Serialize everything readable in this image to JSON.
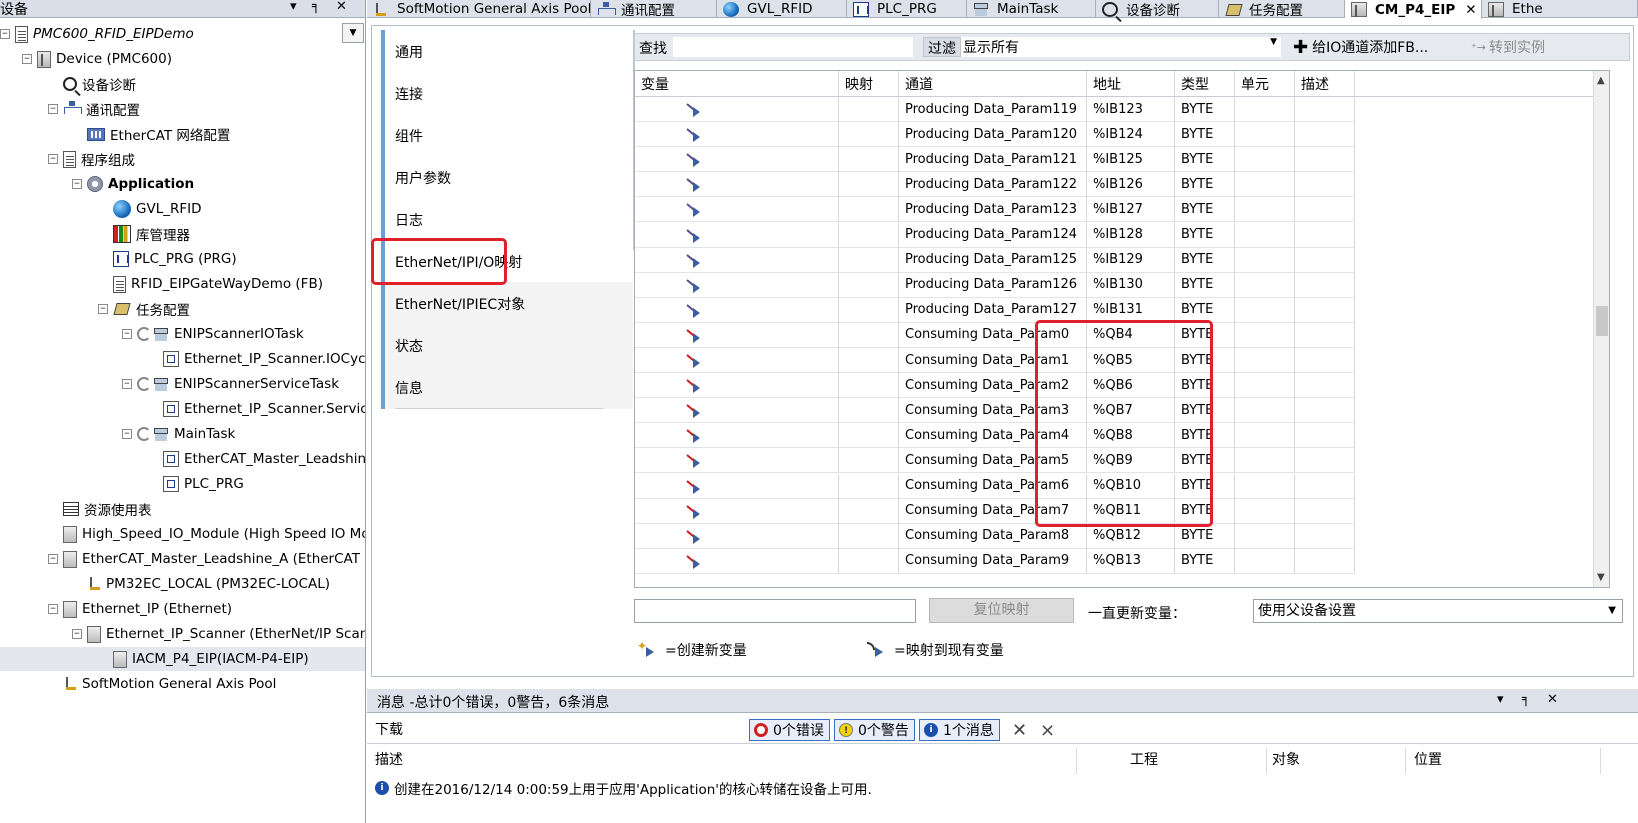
{
  "left_panel": {
    "title": "设备",
    "pin": "▾ ╕ ✕",
    "tree": [
      {
        "label": "PMC600_RFID_EIPDemo",
        "icon": "project-icon",
        "style": "ital",
        "toggle": "⊟"
      },
      {
        "label": "Device (PMC600)",
        "icon": "device-icon",
        "toggle": "⊟"
      },
      {
        "label": "设备诊断",
        "icon": "search-icon"
      },
      {
        "label": "通讯配置",
        "icon": "network-icon",
        "toggle": "⊟"
      },
      {
        "label": "EtherCAT 网络配置",
        "icon": "ethercat-network-icon"
      },
      {
        "label": "程序组成",
        "icon": "program-organization-icon",
        "toggle": "⊟"
      },
      {
        "label": "Application",
        "icon": "application-gear-icon",
        "style": "bold",
        "toggle": "⊟"
      },
      {
        "label": "GVL_RFID",
        "icon": "globe-icon"
      },
      {
        "label": "库管理器",
        "icon": "library-icon"
      },
      {
        "label": "PLC_PRG (PRG)",
        "icon": "program-icon"
      },
      {
        "label": "RFID_EIPGateWayDemo (FB)",
        "icon": "function-block-icon"
      },
      {
        "label": "任务配置",
        "icon": "task-configuration-icon",
        "toggle": "⊟"
      },
      {
        "label": "ENIPScannerIOTask",
        "icon": "task-icon",
        "toggle": "⊟"
      },
      {
        "label": "Ethernet_IP_Scanner.IOCyc",
        "icon": "program-call-icon"
      },
      {
        "label": "ENIPScannerServiceTask",
        "icon": "task-icon",
        "toggle": "⊟"
      },
      {
        "label": "Ethernet_IP_Scanner.Servic",
        "icon": "program-call-icon"
      },
      {
        "label": "MainTask",
        "icon": "task-icon",
        "toggle": "⊟"
      },
      {
        "label": "EtherCAT_Master_Leadshine",
        "icon": "program-call-icon"
      },
      {
        "label": "PLC_PRG",
        "icon": "program-call-icon"
      },
      {
        "label": "资源使用表",
        "icon": "table-icon"
      },
      {
        "label": "High_Speed_IO_Module (High Speed IO Modu",
        "icon": "module-icon"
      },
      {
        "label": "EtherCAT_Master_Leadshine_A (EtherCAT M",
        "icon": "module-icon",
        "toggle": "⊟"
      },
      {
        "label": "PM32EC_LOCAL (PM32EC-LOCAL)",
        "icon": "axis-icon"
      },
      {
        "label": "Ethernet_IP (Ethernet)",
        "icon": "module-icon",
        "toggle": "⊟"
      },
      {
        "label": "Ethernet_IP_Scanner (EtherNet/IP Scann",
        "icon": "module-icon",
        "toggle": "⊟"
      },
      {
        "label": "IACM_P4_EIP(IACM-P4-EIP)",
        "icon": "module-icon",
        "selected": true
      },
      {
        "label": "SoftMotion General Axis Pool",
        "icon": "axis-pool-icon"
      }
    ]
  },
  "tabs": [
    {
      "label": "SoftMotion General Axis Pool",
      "icon": "axis-pool-icon"
    },
    {
      "label": "通讯配置",
      "icon": "network-icon"
    },
    {
      "label": "GVL_RFID",
      "icon": "globe-icon"
    },
    {
      "label": "PLC_PRG",
      "icon": "program-icon"
    },
    {
      "label": "MainTask",
      "icon": "task-icon"
    },
    {
      "label": "设备诊断",
      "icon": "search-icon"
    },
    {
      "label": "任务配置",
      "icon": "task-configuration-icon"
    },
    {
      "label": "CM_P4_EIP",
      "icon": "device-icon",
      "active": true,
      "close": "✕"
    },
    {
      "label": "Ethe",
      "icon": "device-icon"
    }
  ],
  "side_tabs": [
    "通用",
    "连接",
    "组件",
    "用户参数",
    "日志",
    "EtherNet/IPI/O映射",
    "EtherNet/IPIEC对象",
    "状态",
    "信息"
  ],
  "toolbar": {
    "find_label": "查找",
    "filter_label": "过滤",
    "filter_value": "显示所有",
    "add_fb_label": "给IO通道添加FB...",
    "goto_instance_label": "转到实例"
  },
  "grid": {
    "headers": [
      "变量",
      "映射",
      "通道",
      "地址",
      "类型",
      "单元",
      "描述"
    ],
    "rows": [
      {
        "dir": "in",
        "channel": "Producing Data_Param119",
        "address": "%IB123",
        "type": "BYTE"
      },
      {
        "dir": "in",
        "channel": "Producing Data_Param120",
        "address": "%IB124",
        "type": "BYTE"
      },
      {
        "dir": "in",
        "channel": "Producing Data_Param121",
        "address": "%IB125",
        "type": "BYTE"
      },
      {
        "dir": "in",
        "channel": "Producing Data_Param122",
        "address": "%IB126",
        "type": "BYTE"
      },
      {
        "dir": "in",
        "channel": "Producing Data_Param123",
        "address": "%IB127",
        "type": "BYTE"
      },
      {
        "dir": "in",
        "channel": "Producing Data_Param124",
        "address": "%IB128",
        "type": "BYTE"
      },
      {
        "dir": "in",
        "channel": "Producing Data_Param125",
        "address": "%IB129",
        "type": "BYTE"
      },
      {
        "dir": "in",
        "channel": "Producing Data_Param126",
        "address": "%IB130",
        "type": "BYTE"
      },
      {
        "dir": "in",
        "channel": "Producing Data_Param127",
        "address": "%IB131",
        "type": "BYTE"
      },
      {
        "dir": "out",
        "channel": "Consuming Data_Param0",
        "address": "%QB4",
        "type": "BYTE"
      },
      {
        "dir": "out",
        "channel": "Consuming Data_Param1",
        "address": "%QB5",
        "type": "BYTE"
      },
      {
        "dir": "out",
        "channel": "Consuming Data_Param2",
        "address": "%QB6",
        "type": "BYTE"
      },
      {
        "dir": "out",
        "channel": "Consuming Data_Param3",
        "address": "%QB7",
        "type": "BYTE"
      },
      {
        "dir": "out",
        "channel": "Consuming Data_Param4",
        "address": "%QB8",
        "type": "BYTE"
      },
      {
        "dir": "out",
        "channel": "Consuming Data_Param5",
        "address": "%QB9",
        "type": "BYTE"
      },
      {
        "dir": "out",
        "channel": "Consuming Data_Param6",
        "address": "%QB10",
        "type": "BYTE"
      },
      {
        "dir": "out",
        "channel": "Consuming Data_Param7",
        "address": "%QB11",
        "type": "BYTE"
      },
      {
        "dir": "out",
        "channel": "Consuming Data_Param8",
        "address": "%QB12",
        "type": "BYTE"
      },
      {
        "dir": "out",
        "channel": "Consuming Data_Param9",
        "address": "%QB13",
        "type": "BYTE"
      }
    ]
  },
  "bottom": {
    "reset_button": "复位映射",
    "always_update_label": "一直更新变量：",
    "update_select_value": "使用父设备设置",
    "legend_new": "=创建新变量",
    "legend_map": "=映射到现有变量"
  },
  "messages": {
    "title": "消息 -总计0个错误，0警告，6条消息",
    "source": "下载",
    "errors_label": "0个错误",
    "warnings_label": "0个警告",
    "info_label": "1个消息",
    "headers": [
      "描述",
      "工程",
      "对象",
      "位置"
    ],
    "row_text": "创建在2016/12/14 0:00:59上用于应用'Application'的核心转储在设备上可用."
  },
  "colors": {
    "highlight": "#e0202a",
    "accent": "#6f9ed6"
  }
}
